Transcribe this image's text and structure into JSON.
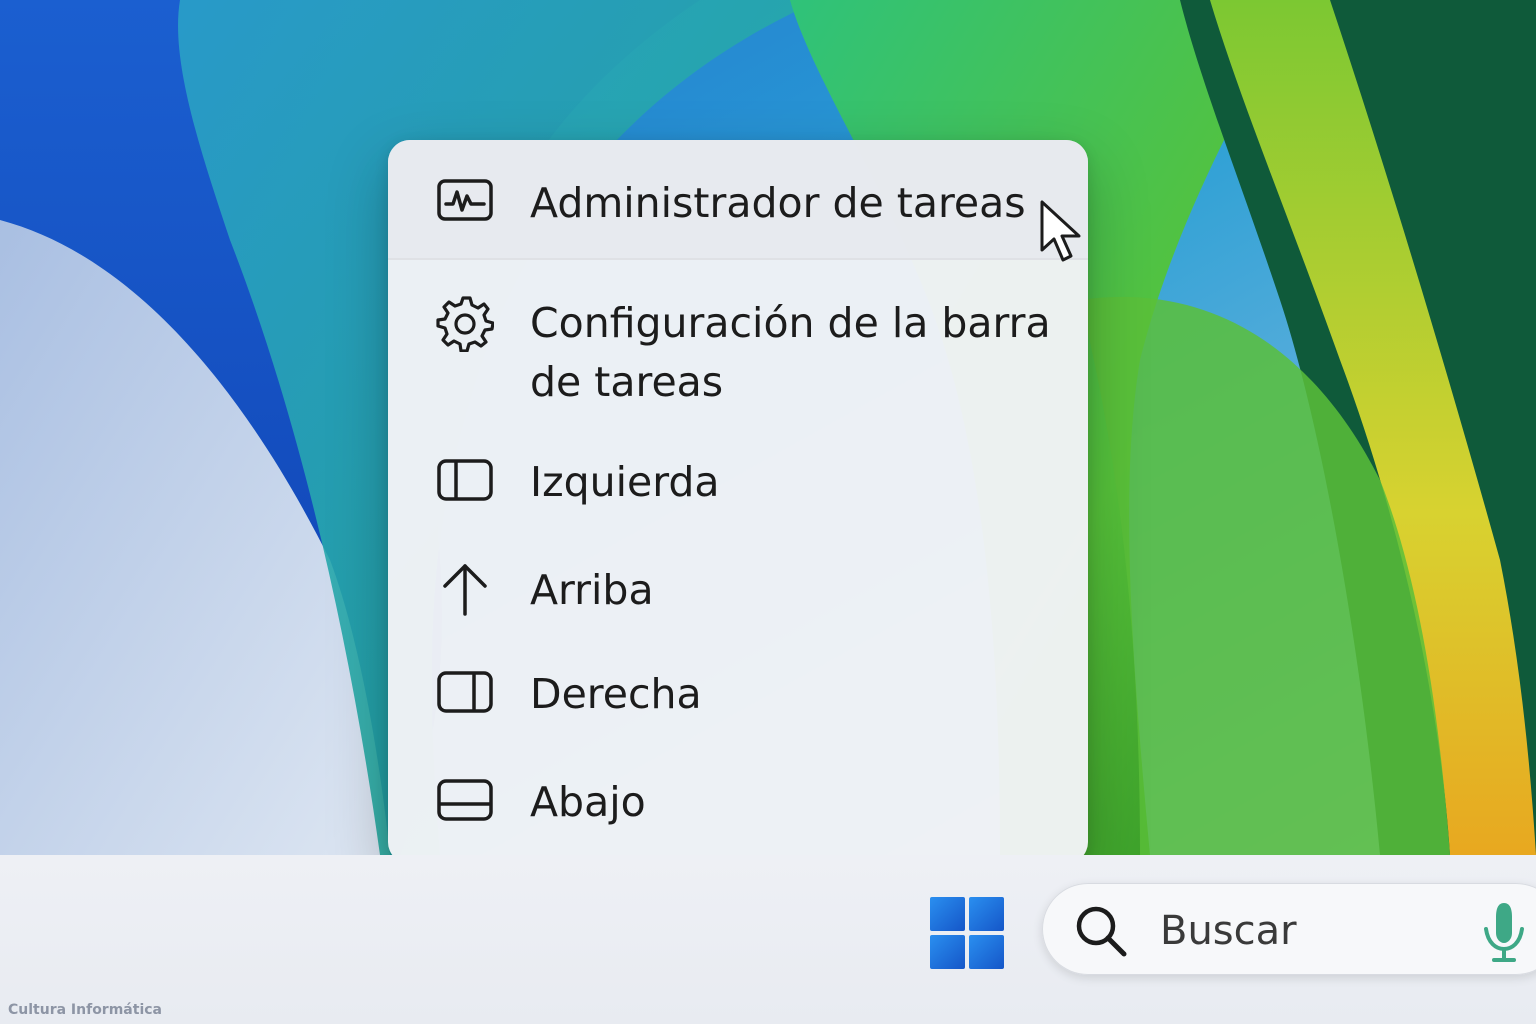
{
  "menu": {
    "items": [
      {
        "label": "Administrador de tareas",
        "icon": "task-manager-icon"
      },
      {
        "label": "Configuración de la barra de tareas",
        "icon": "gear-icon"
      },
      {
        "label": "Izquierda",
        "icon": "panel-left-icon"
      },
      {
        "label": "Arriba",
        "icon": "arrow-up-icon"
      },
      {
        "label": "Derecha",
        "icon": "panel-right-icon"
      },
      {
        "label": "Abajo",
        "icon": "panel-bottom-icon"
      }
    ]
  },
  "taskbar": {
    "search_placeholder": "Buscar"
  },
  "watermark": "Cultura Informática",
  "colors": {
    "menu_background": "#f2f3f6",
    "text": "#1c1c1c",
    "windows_logo": "#1f6fd6"
  }
}
